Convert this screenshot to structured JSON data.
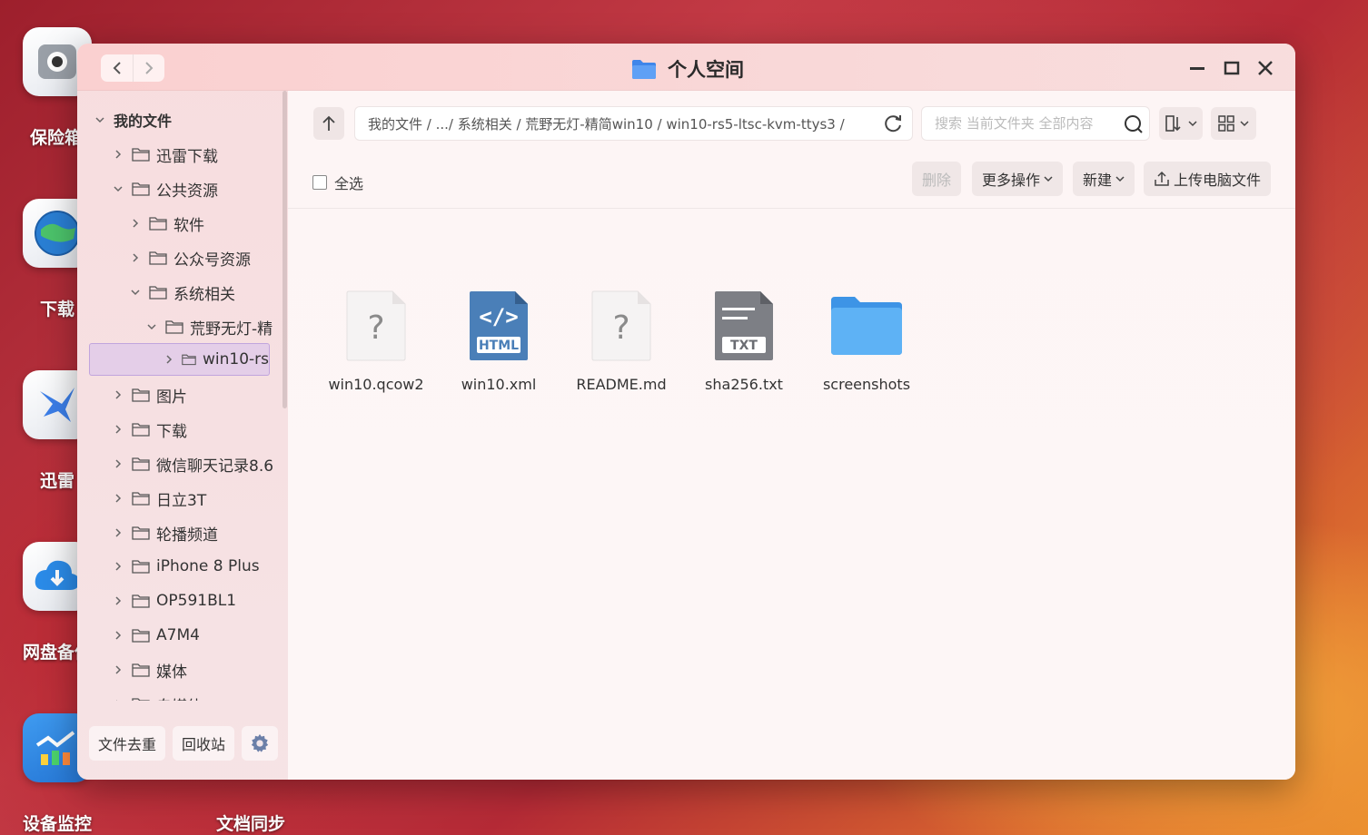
{
  "desktop": {
    "icons": [
      {
        "label": "保险箱"
      },
      {
        "label": "下载"
      },
      {
        "label": "迅雷"
      },
      {
        "label": "网盘备份"
      },
      {
        "label": "设备监控"
      },
      {
        "label": "文档同步"
      }
    ]
  },
  "window": {
    "title": "个人空间"
  },
  "sidebar": {
    "tree": [
      {
        "label": "我的文件"
      },
      {
        "label": "迅雷下载"
      },
      {
        "label": "公共资源"
      },
      {
        "label": "软件"
      },
      {
        "label": "公众号资源"
      },
      {
        "label": "系统相关"
      },
      {
        "label": "荒野无灯-精"
      },
      {
        "label": "win10-rs"
      },
      {
        "label": "图片"
      },
      {
        "label": "下载"
      },
      {
        "label": "微信聊天记录8.6"
      },
      {
        "label": "日立3T"
      },
      {
        "label": "轮播频道"
      },
      {
        "label": "iPhone 8 Plus"
      },
      {
        "label": "OP591BL1"
      },
      {
        "label": "A7M4"
      },
      {
        "label": "媒体"
      },
      {
        "label": "自媒体"
      }
    ],
    "dedupe_label": "文件去重",
    "recycle_label": "回收站"
  },
  "main": {
    "path": "我的文件 / .../ 系统相关 / 荒野无灯-精简win10 / win10-rs5-ltsc-kvm-ttys3 /",
    "search_placeholder": "搜索 当前文件夹 全部内容",
    "select_all": "全选",
    "delete_label": "删除",
    "more_label": "更多操作",
    "new_label": "新建",
    "upload_label": "上传电脑文件",
    "files": [
      {
        "name": "win10.qcow2",
        "icon": "unknown-file-icon"
      },
      {
        "name": "win10.xml",
        "icon": "html-file-icon",
        "badge": "HTML"
      },
      {
        "name": "README.md",
        "icon": "unknown-file-icon"
      },
      {
        "name": "sha256.txt",
        "icon": "txt-file-icon",
        "badge": "TXT"
      },
      {
        "name": "screenshots",
        "icon": "folder-icon"
      }
    ]
  },
  "colors": {
    "accent_folder": "#4aa8f0",
    "html_icon": "#4a7fb8",
    "txt_icon": "#7d7f85"
  }
}
